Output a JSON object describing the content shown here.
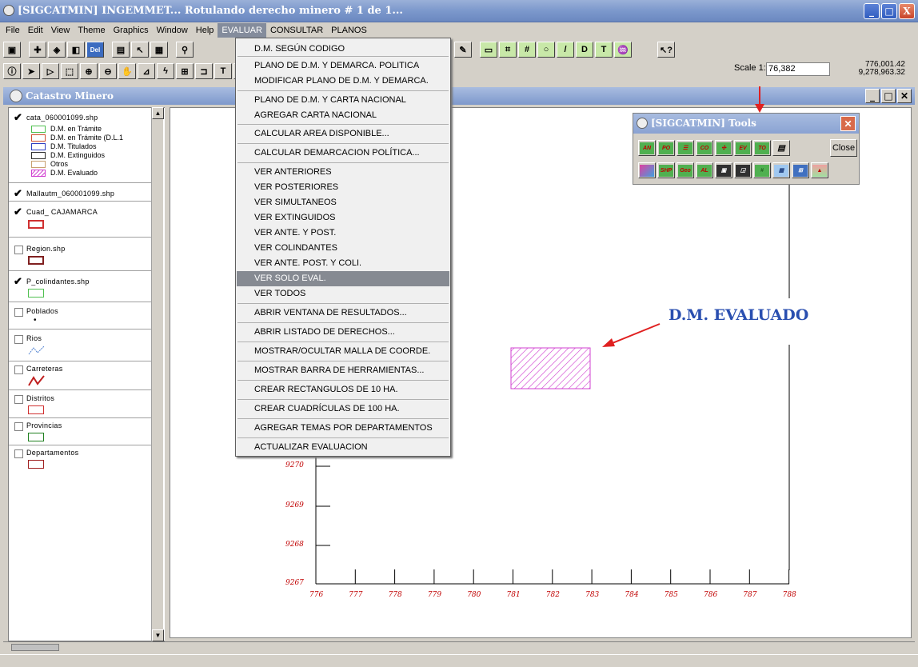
{
  "window": {
    "title": "[SIGCATMIN] INGEMMET... Rotulando derecho minero # 1 de 1...",
    "controls": [
      "_",
      "□",
      "X"
    ]
  },
  "menubar": {
    "items": [
      "File",
      "Edit",
      "View",
      "Theme",
      "Graphics",
      "Window",
      "Help",
      "EVALUAR",
      "CONSULTAR",
      "PLANOS"
    ],
    "active_index": 7
  },
  "scale": {
    "label": "Scale 1:",
    "value": "76,382"
  },
  "coords": {
    "x": "776,001.42",
    "y": "9,278,963.32"
  },
  "inner_window": {
    "title": "Catastro Minero"
  },
  "legend": {
    "themes": [
      {
        "name": "cata_060001099.shp",
        "checked": true,
        "subs": [
          {
            "label": "D.M. en Trámite",
            "color": "#50c050"
          },
          {
            "label": "D.M. en Trámite (D.L.1",
            "color": "#d05030"
          },
          {
            "label": "D.M. Titulados",
            "color": "#3040c0"
          },
          {
            "label": "D.M. Extinguidos",
            "color": "#303030"
          },
          {
            "label": "Otros",
            "color": "#c8a070"
          },
          {
            "label": "D.M. Evaluado",
            "color": "#d040d0"
          }
        ]
      },
      {
        "name": "Mallautm_060001099.shp",
        "checked": true
      },
      {
        "name": "Cuad_ CAJAMARCA",
        "checked": true,
        "color": "#d03030"
      },
      {
        "name": "Region.shp",
        "checked": false,
        "color": "#802020"
      },
      {
        "name": "P_colindantes.shp",
        "checked": true,
        "color": "#50c050"
      },
      {
        "name": "Poblados",
        "checked": false
      },
      {
        "name": "Rios",
        "checked": false
      },
      {
        "name": "Carreteras",
        "checked": false
      },
      {
        "name": "Distritos",
        "checked": false,
        "color": "#d03030"
      },
      {
        "name": "Provincias",
        "checked": false,
        "color": "#208020"
      },
      {
        "name": "Departamentos",
        "checked": false,
        "color": "#a02020"
      }
    ]
  },
  "dropdown": {
    "items": [
      "D.M. SEGÚN CODIGO",
      "PLANO DE D.M. Y DEMARCA. POLITICA",
      "MODIFICAR PLANO DE D.M. Y DEMARCA.",
      "PLANO DE D.M. Y CARTA NACIONAL",
      "AGREGAR CARTA NACIONAL",
      "CALCULAR AREA DISPONIBLE...",
      "CALCULAR DEMARCACION POLÍTICA...",
      "VER ANTERIORES",
      "VER POSTERIORES",
      "VER SIMULTANEOS",
      "VER EXTINGUIDOS",
      "VER ANTE. Y POST.",
      "VER COLINDANTES",
      "VER ANTE. POST. Y COLI.",
      "VER SOLO EVAL.",
      "VER TODOS",
      "ABRIR VENTANA DE RESULTADOS...",
      "ABRIR LISTADO DE DERECHOS...",
      "MOSTRAR/OCULTAR MALLA DE COORDE.",
      "MOSTRAR BARRA DE HERRAMIENTAS...",
      "CREAR RECTANGULOS DE 10 HA.",
      "CREAR CUADRÍCULAS DE 100 HA.",
      "AGREGAR TEMAS POR DEPARTAMENTOS",
      "ACTUALIZAR EVALUACION"
    ],
    "selected_index": 14
  },
  "tools": {
    "title": "[SIGCATMIN] Tools",
    "row1": [
      "AN",
      "PO",
      "",
      "CO",
      "",
      "EV",
      "TO",
      ""
    ],
    "row2": [
      "",
      "SHP",
      "Geo",
      "AL",
      "",
      "",
      "",
      "",
      "",
      ""
    ],
    "close_label": "Close"
  },
  "annotation": {
    "label": "D.M. EVALUADO"
  },
  "map": {
    "y_labels": [
      "9270",
      "9269",
      "9268",
      "9267"
    ],
    "x_labels": [
      "776",
      "777",
      "778",
      "779",
      "780",
      "781",
      "782",
      "783",
      "784",
      "785",
      "786",
      "787",
      "788"
    ],
    "colors": {
      "grid": "#000000",
      "labels": "#c00000",
      "evaluado": "#d040d0",
      "arrow": "#e02020"
    }
  }
}
